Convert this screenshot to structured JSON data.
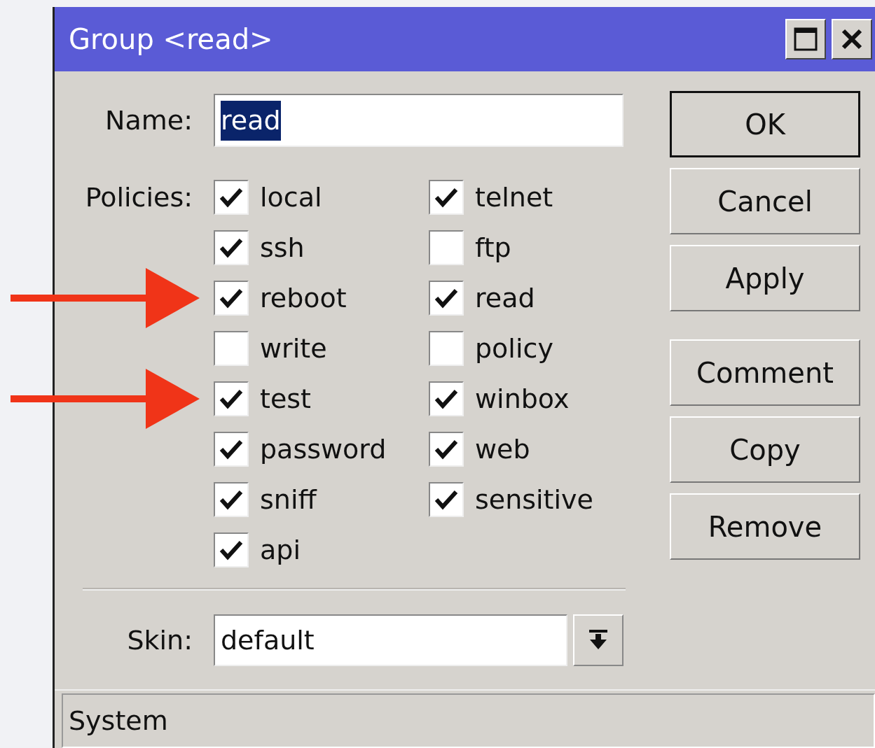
{
  "window": {
    "title": "Group <read>"
  },
  "name_field": {
    "label": "Name:",
    "value": "read",
    "text_selected": true
  },
  "policies": {
    "label": "Policies:",
    "columns": [
      [
        {
          "label": "local",
          "checked": true,
          "marked": false
        },
        {
          "label": "ssh",
          "checked": true,
          "marked": false
        },
        {
          "label": "reboot",
          "checked": true,
          "marked": true
        },
        {
          "label": "write",
          "checked": false,
          "marked": false
        },
        {
          "label": "test",
          "checked": true,
          "marked": true
        },
        {
          "label": "password",
          "checked": true,
          "marked": false
        },
        {
          "label": "sniff",
          "checked": true,
          "marked": false
        },
        {
          "label": "api",
          "checked": true,
          "marked": false
        }
      ],
      [
        {
          "label": "telnet",
          "checked": true,
          "marked": false
        },
        {
          "label": "ftp",
          "checked": false,
          "marked": false
        },
        {
          "label": "read",
          "checked": true,
          "marked": false
        },
        {
          "label": "policy",
          "checked": false,
          "marked": false
        },
        {
          "label": "winbox",
          "checked": true,
          "marked": false
        },
        {
          "label": "web",
          "checked": true,
          "marked": false
        },
        {
          "label": "sensitive",
          "checked": true,
          "marked": false
        }
      ]
    ]
  },
  "skin_field": {
    "label": "Skin:",
    "value": "default"
  },
  "buttons": [
    {
      "label": "OK",
      "default": true
    },
    {
      "label": "Cancel",
      "default": false
    },
    {
      "label": "Apply",
      "default": false
    },
    {
      "label": "Comment",
      "default": false
    },
    {
      "label": "Copy",
      "default": false
    },
    {
      "label": "Remove",
      "default": false
    }
  ],
  "status_bar": "System"
}
